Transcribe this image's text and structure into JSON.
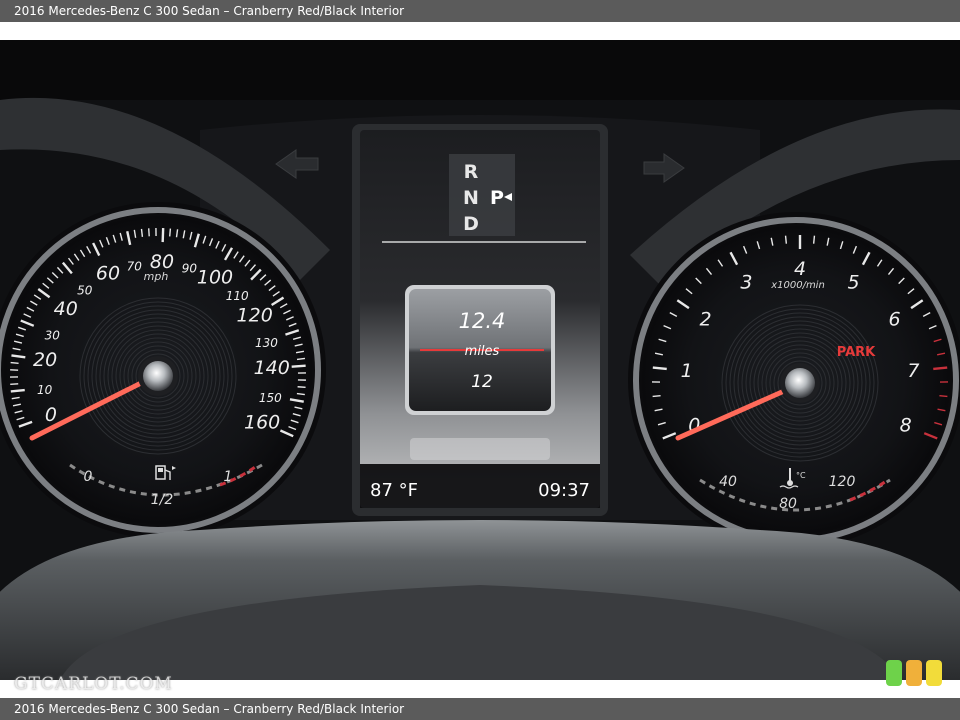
{
  "caption": {
    "top": "2016 Mercedes-Benz C 300 Sedan – Cranberry Red/Black Interior",
    "bottom": "2016 Mercedes-Benz C 300 Sedan – Cranberry Red/Black Interior"
  },
  "watermark": "GTCARLOT.COM",
  "speedometer": {
    "unit": "mph",
    "labels": [
      "0",
      "10",
      "20",
      "30",
      "40",
      "50",
      "60",
      "70",
      "80",
      "90",
      "100",
      "110",
      "120",
      "130",
      "140",
      "150",
      "160"
    ],
    "needle_value": 0
  },
  "fuel": {
    "left": "0",
    "mid": "1/2",
    "right": "1"
  },
  "tachometer": {
    "unit": "x1000/min",
    "labels": [
      "0",
      "1",
      "2",
      "3",
      "4",
      "5",
      "6",
      "7",
      "8"
    ],
    "status": "PARK"
  },
  "coolant": {
    "left": "40",
    "mid": "80",
    "right": "120"
  },
  "gear": {
    "r": "R",
    "n": "N",
    "p": "P",
    "d": "D"
  },
  "trip": {
    "distance": "12.4",
    "unit": "miles",
    "second": "12"
  },
  "status_bar": {
    "temperature": "87 °F",
    "clock": "09:37"
  },
  "colors": {
    "needle": "#ff6a5a",
    "redline": "#c8313c",
    "accent_red": "#e63a3a"
  }
}
